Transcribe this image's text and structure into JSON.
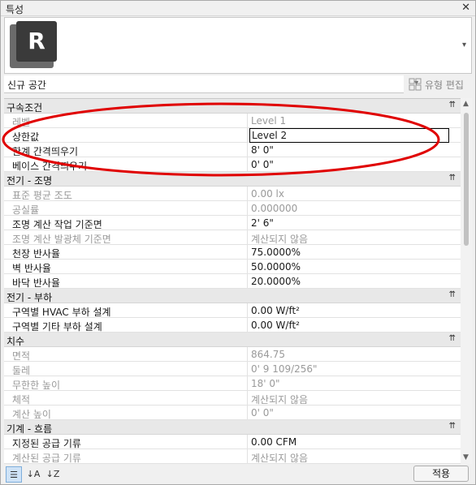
{
  "window": {
    "title": "특성",
    "close": "✕"
  },
  "type_selector": {
    "selected": "신규 공간"
  },
  "edit_type": {
    "label": "유형 편집"
  },
  "groups": [
    {
      "title": "구속조건",
      "collapse": "⇈",
      "rows": [
        {
          "name": "레벨",
          "value": "Level 1",
          "disabled": true
        },
        {
          "name": "상한값",
          "value": "Level 2",
          "disabled": false,
          "editing": true
        },
        {
          "name": "한계 간격띄우기",
          "value": "8'  0\"",
          "disabled": false
        },
        {
          "name": "베이스 간격띄우기",
          "value": "0'  0\"",
          "disabled": false
        }
      ]
    },
    {
      "title": "전기 - 조명",
      "collapse": "⇈",
      "rows": [
        {
          "name": "표준 평균 조도",
          "value": "0.00 lx",
          "disabled": true
        },
        {
          "name": "공실률",
          "value": "0.000000",
          "disabled": true
        },
        {
          "name": "조명 계산 작업 기준면",
          "value": "2'  6\"",
          "disabled": false
        },
        {
          "name": "조명 계산 발광체 기준면",
          "value": "계산되지 않음",
          "disabled": true
        },
        {
          "name": "천장 반사율",
          "value": "75.0000%",
          "disabled": false
        },
        {
          "name": "벽 반사율",
          "value": "50.0000%",
          "disabled": false
        },
        {
          "name": "바닥 반사율",
          "value": "20.0000%",
          "disabled": false
        }
      ]
    },
    {
      "title": "전기 - 부하",
      "collapse": "⇈",
      "rows": [
        {
          "name": "구역별 HVAC 부하 설계",
          "value": "0.00 W/ft²",
          "disabled": false
        },
        {
          "name": "구역별 기타 부하 설계",
          "value": "0.00 W/ft²",
          "disabled": false
        }
      ]
    },
    {
      "title": "치수",
      "collapse": "⇈",
      "rows": [
        {
          "name": "면적",
          "value": "864.75",
          "disabled": true
        },
        {
          "name": "둘레",
          "value": "0'  9 109/256\"",
          "disabled": true
        },
        {
          "name": "무한한 높이",
          "value": "18'  0\"",
          "disabled": true
        },
        {
          "name": "체적",
          "value": "계산되지 않음",
          "disabled": true
        },
        {
          "name": "계산 높이",
          "value": "0'  0\"",
          "disabled": true
        }
      ]
    },
    {
      "title": "기계 - 흐름",
      "collapse": "⇈",
      "rows": [
        {
          "name": "지정된 공급 기류",
          "value": "0.00 CFM",
          "disabled": false
        },
        {
          "name": "계산된 공급 기류",
          "value": "계산되지 않음",
          "disabled": true
        }
      ]
    }
  ],
  "bottom": {
    "apply_label": "적용"
  },
  "icons": {
    "logo": "revit-logo-icon",
    "sort_categorized": "sort-categorized-icon",
    "sort_az": "sort-az-icon",
    "sort_za": "sort-za-icon"
  },
  "colors": {
    "annotation": "#e00000",
    "logo_bg": "#3a3a3a",
    "logo_back": "#6b6b6b"
  }
}
